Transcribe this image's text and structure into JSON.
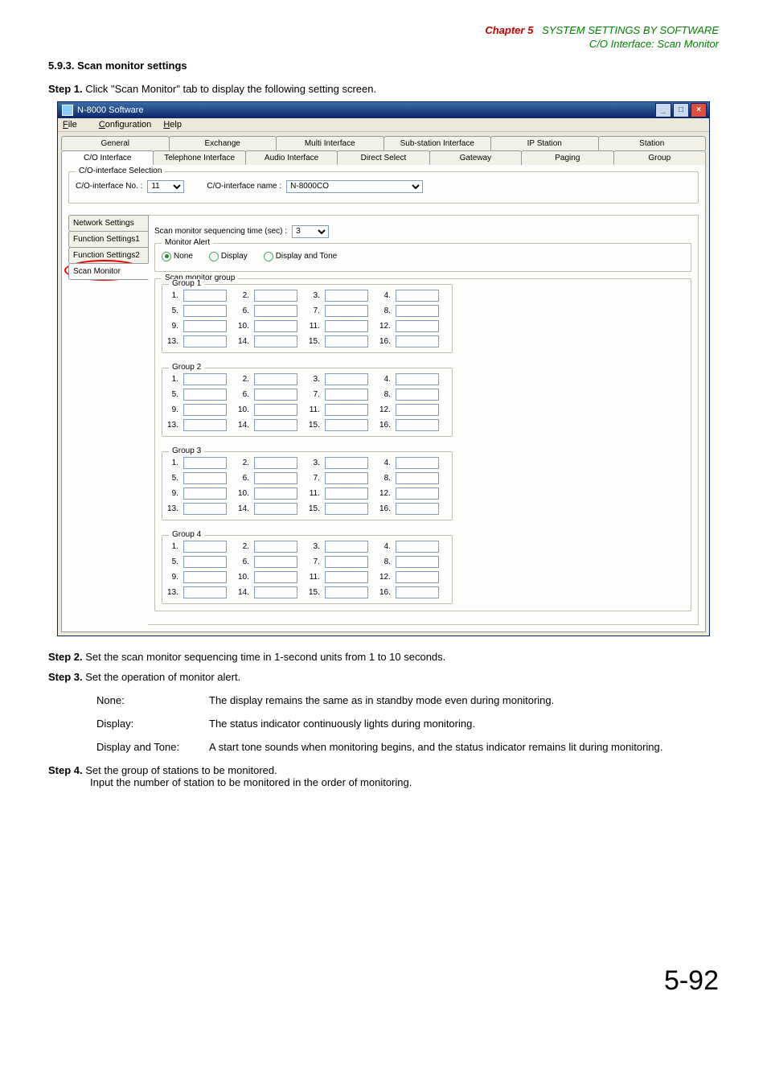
{
  "header": {
    "chapter_label": "Chapter 5",
    "chapter_title": "SYSTEM SETTINGS BY SOFTWARE",
    "sub": "C/O Interface: Scan Monitor"
  },
  "section_number": "5.9.3. Scan monitor settings",
  "steps": {
    "s1_label": "Step 1.",
    "s1_text": "Click \"Scan Monitor\" tab to display the following setting screen.",
    "s2_label": "Step 2.",
    "s2_text": "Set the scan monitor sequencing time in 1-second units from 1 to 10 seconds.",
    "s3_label": "Step 3.",
    "s3_text": "Set the operation of monitor alert.",
    "s4_label": "Step 4.",
    "s4_text_a": "Set the group of stations to be monitored.",
    "s4_text_b": "Input the number of station to be monitored in the order of monitoring."
  },
  "defs": {
    "none_k": "None:",
    "none_v": "The display remains the same as in standby mode even during monitoring.",
    "disp_k": "Display:",
    "disp_v": "The status indicator continuously lights during monitoring.",
    "dt_k": "Display and Tone:",
    "dt_v": "A start tone sounds when monitoring begins, and the status indicator remains lit during monitoring."
  },
  "page_number": "5-92",
  "window": {
    "title": "N-8000 Software",
    "menu": {
      "file": "File",
      "config": "Configuration",
      "help": "Help"
    },
    "tabs_row1": [
      "General",
      "Exchange",
      "Multi Interface",
      "Sub-station Interface",
      "IP Station",
      "Station"
    ],
    "tabs_row2": [
      "C/O Interface",
      "Telephone Interface",
      "Audio Interface",
      "Direct Select",
      "Gateway",
      "Paging",
      "Group"
    ],
    "tabs_row2_active": "C/O Interface",
    "co_selection": {
      "legend": "C/O-interface Selection",
      "no_label": "C/O-interface No. :",
      "no_value": "11",
      "name_label": "C/O-interface name :",
      "name_value": "N-8000CO"
    },
    "sidetabs": [
      "Network Settings",
      "Function Settings1",
      "Function Settings2",
      "Scan Monitor"
    ],
    "sidetab_active": "Scan Monitor",
    "seq": {
      "label": "Scan monitor sequencing time (sec) :",
      "value": "3"
    },
    "monitor_alert": {
      "legend": "Monitor Alert",
      "options": [
        "None",
        "Display",
        "Display and Tone"
      ],
      "selected": "None"
    },
    "smg_legend": "Scan monitor group",
    "groups": [
      {
        "title": "Group 1",
        "labels": [
          "1.",
          "2.",
          "3.",
          "4.",
          "5.",
          "6.",
          "7.",
          "8.",
          "9.",
          "10.",
          "11.",
          "12.",
          "13.",
          "14.",
          "15.",
          "16."
        ]
      },
      {
        "title": "Group 2",
        "labels": [
          "1.",
          "2.",
          "3.",
          "4.",
          "5.",
          "6.",
          "7.",
          "8.",
          "9.",
          "10.",
          "11.",
          "12.",
          "13.",
          "14.",
          "15.",
          "16."
        ]
      },
      {
        "title": "Group 3",
        "labels": [
          "1.",
          "2.",
          "3.",
          "4.",
          "5.",
          "6.",
          "7.",
          "8.",
          "9.",
          "10.",
          "11.",
          "12.",
          "13.",
          "14.",
          "15.",
          "16."
        ]
      },
      {
        "title": "Group 4",
        "labels": [
          "1.",
          "2.",
          "3.",
          "4.",
          "5.",
          "6.",
          "7.",
          "8.",
          "9.",
          "10.",
          "11.",
          "12.",
          "13.",
          "14.",
          "15.",
          "16."
        ]
      }
    ]
  }
}
